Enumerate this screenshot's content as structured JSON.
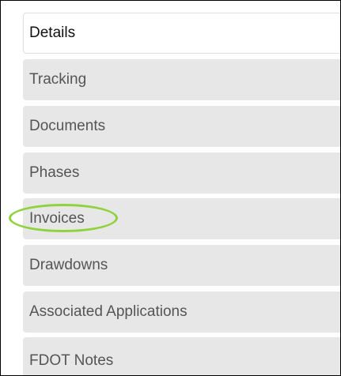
{
  "tabs": [
    {
      "label": "Details",
      "active": true
    },
    {
      "label": "Tracking",
      "active": false
    },
    {
      "label": "Documents",
      "active": false
    },
    {
      "label": "Phases",
      "active": false
    },
    {
      "label": "Invoices",
      "active": false,
      "highlighted": true
    },
    {
      "label": "Drawdowns",
      "active": false
    },
    {
      "label": "Associated Applications",
      "active": false
    },
    {
      "label": "FDOT Notes",
      "active": false
    }
  ],
  "colors": {
    "active_tab_bg": "#ffffff",
    "inactive_tab_bg": "#e7e7e7",
    "inactive_text": "#555555",
    "active_text": "#111111",
    "highlight_ring": "#8fd23c"
  }
}
